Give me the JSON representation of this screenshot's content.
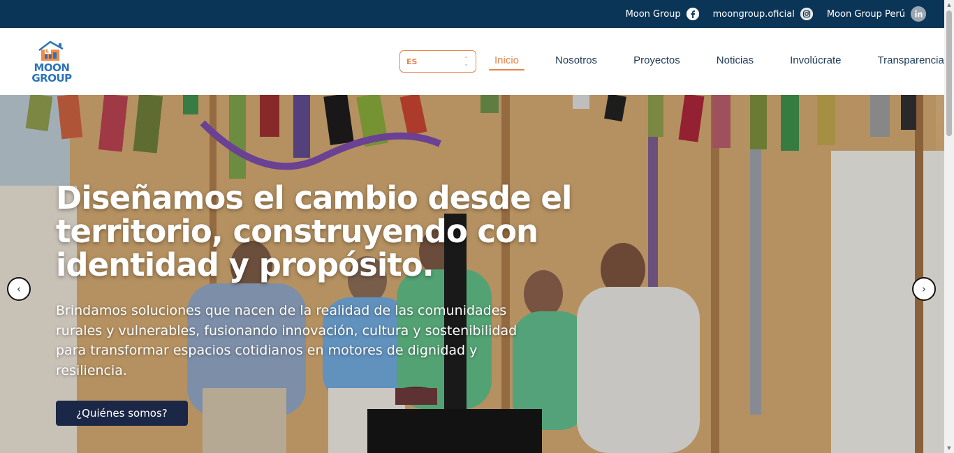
{
  "topbar": {
    "socials": [
      {
        "label": "Moon Group",
        "icon": "facebook-icon"
      },
      {
        "label": "moongroup.oficial",
        "icon": "instagram-icon"
      },
      {
        "label": "Moon Group Perú",
        "icon": "linkedin-icon"
      }
    ]
  },
  "header": {
    "logo_line1": "MOON",
    "logo_line2": "GROUP",
    "language": "ES",
    "nav": [
      {
        "label": "Inicio",
        "active": true
      },
      {
        "label": "Nosotros"
      },
      {
        "label": "Proyectos"
      },
      {
        "label": "Noticias"
      },
      {
        "label": "Involúcrate"
      },
      {
        "label": "Transparencia"
      }
    ]
  },
  "hero": {
    "title": "Diseñamos el cambio desde el territorio, construyendo con identidad y propósito.",
    "subtitle": "Brindamos soluciones que nacen de la realidad de las comunidades rurales y vulnerables, fusionando innovación, cultura y sostenibilidad para transformar espacios cotidianos en motores de dignidad y resiliencia.",
    "cta_label": "¿Quiénes somos?",
    "prev_icon": "‹",
    "next_icon": "›"
  },
  "colors": {
    "topbar": "#0b3557",
    "accent": "#e6834a",
    "nav_text": "#1b3a57",
    "cta_bg": "#1a2746",
    "logo_blue": "#2d73b9"
  }
}
